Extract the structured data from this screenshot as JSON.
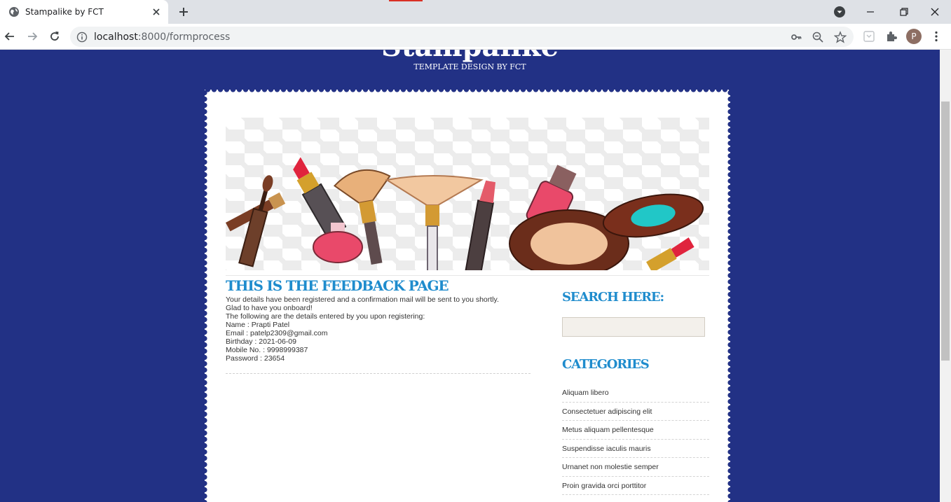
{
  "browser": {
    "tab_title": "Stampalike by FCT",
    "url_host": "localhost",
    "url_rest": ":8000/formprocess",
    "profile_initial": "P"
  },
  "site": {
    "title": "Stampalike",
    "tagline": "TEMPLATE DESIGN BY FCT"
  },
  "content": {
    "heading": "THIS IS THE FEEDBACK PAGE",
    "lines": [
      "Your details have been registered and a confirmation mail will be sent to you shortly.",
      "Glad to have you onboard!",
      "The following are the details entered by you upon registering:",
      "Name : Prapti Patel",
      "Email : patelp2309@gmail.com",
      "Birthday : 2021-06-09",
      "Mobile No. : 9998999387",
      "Password : 23654"
    ]
  },
  "sidebar": {
    "search_heading": "SEARCH HERE:",
    "search_value": "",
    "categories_heading": "CATEGORIES",
    "categories": [
      "Aliquam libero",
      "Consectetuer adipiscing elit",
      "Metus aliquam pellentesque",
      "Suspendisse iaculis mauris",
      "Urnanet non molestie semper",
      "Proin gravida orci porttitor"
    ]
  },
  "colors": {
    "page_background": "#223185",
    "heading_accent": "#1f8ccd"
  }
}
